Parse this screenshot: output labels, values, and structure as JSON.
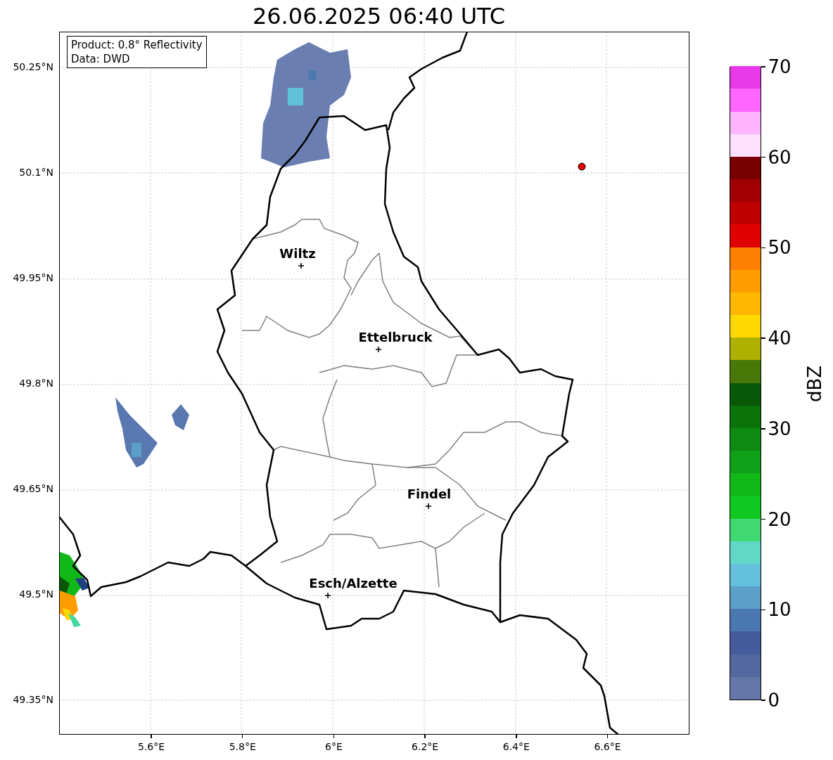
{
  "title": "26.06.2025 06:40 UTC",
  "info_box": {
    "lines": [
      "Product: 0.8° Reflectivity",
      "Data: DWD"
    ]
  },
  "map": {
    "lat_ticks": [
      "50.25°N",
      "50.1°N",
      "49.95°N",
      "49.8°N",
      "49.65°N",
      "49.5°N",
      "49.35°N"
    ],
    "lon_ticks": [
      "5.6°E",
      "5.8°E",
      "6°E",
      "6.2°E",
      "6.4°E",
      "6.6°E"
    ],
    "cities": [
      {
        "name": "Wiltz"
      },
      {
        "name": "Ettelbruck"
      },
      {
        "name": "Findel"
      },
      {
        "name": "Esch/Alzette"
      }
    ]
  },
  "colorbar": {
    "label": "dBZ",
    "ticks": [
      "70",
      "60",
      "50",
      "40",
      "30",
      "20",
      "10",
      "0"
    ],
    "bins": [
      {
        "color": "#6477a8"
      },
      {
        "color": "#52689f"
      },
      {
        "color": "#445c9c"
      },
      {
        "color": "#4a78b0"
      },
      {
        "color": "#5aa0c8"
      },
      {
        "color": "#64c0dc"
      },
      {
        "color": "#60d8c8"
      },
      {
        "color": "#40d870"
      },
      {
        "color": "#10c820"
      },
      {
        "color": "#10b818"
      },
      {
        "color": "#10a018"
      },
      {
        "color": "#0e8a12"
      },
      {
        "color": "#0a740a"
      },
      {
        "color": "#085808"
      },
      {
        "color": "#487808"
      },
      {
        "color": "#b0b000"
      },
      {
        "color": "#ffd800"
      },
      {
        "color": "#ffb800"
      },
      {
        "color": "#ff9c00"
      },
      {
        "color": "#ff8000"
      },
      {
        "color": "#e00000"
      },
      {
        "color": "#c00000"
      },
      {
        "color": "#a00000"
      },
      {
        "color": "#780000"
      },
      {
        "color": "#ffe0ff"
      },
      {
        "color": "#ffb4ff"
      },
      {
        "color": "#ff66ff"
      },
      {
        "color": "#e838e8"
      }
    ]
  }
}
